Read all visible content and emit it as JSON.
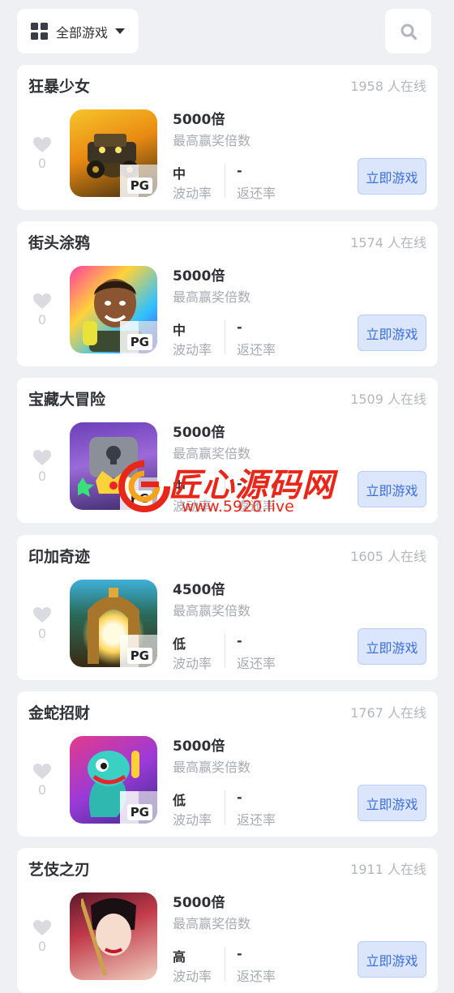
{
  "header": {
    "filter_label": "全部游戏",
    "filter_icon": "grid-icon",
    "search_icon": "search-icon"
  },
  "labels": {
    "max_win": "最高赢奖倍数",
    "volatility": "波动率",
    "rtp": "返还率",
    "play": "立即游戏",
    "provider": "PG"
  },
  "games": [
    {
      "title": "狂暴少女",
      "online": "1958 人在线",
      "favorites": "0",
      "multiplier": "5000倍",
      "volatility": "中",
      "rtp": "-"
    },
    {
      "title": "街头涂鸦",
      "online": "1574 人在线",
      "favorites": "0",
      "multiplier": "5000倍",
      "volatility": "中",
      "rtp": "-"
    },
    {
      "title": "宝藏大冒险",
      "online": "1509 人在线",
      "favorites": "0",
      "multiplier": "5000倍",
      "volatility": "中",
      "rtp": "-"
    },
    {
      "title": "印加奇迹",
      "online": "1605 人在线",
      "favorites": "0",
      "multiplier": "4500倍",
      "volatility": "低",
      "rtp": "-"
    },
    {
      "title": "金蛇招财",
      "online": "1767 人在线",
      "favorites": "0",
      "multiplier": "5000倍",
      "volatility": "低",
      "rtp": "-"
    },
    {
      "title": "艺伎之刃",
      "online": "1911 人在线",
      "favorites": "0",
      "multiplier": "5000倍",
      "volatility": "高",
      "rtp": "-"
    }
  ],
  "watermark": {
    "brand": "匠心源码网",
    "url": "www.5920.live"
  },
  "colors": {
    "page_bg": "#eef0f4",
    "card_bg": "#ffffff",
    "play_button_bg": "#dbe6fd",
    "play_button_text": "#3d6fd9",
    "watermark": "#e8261a"
  }
}
